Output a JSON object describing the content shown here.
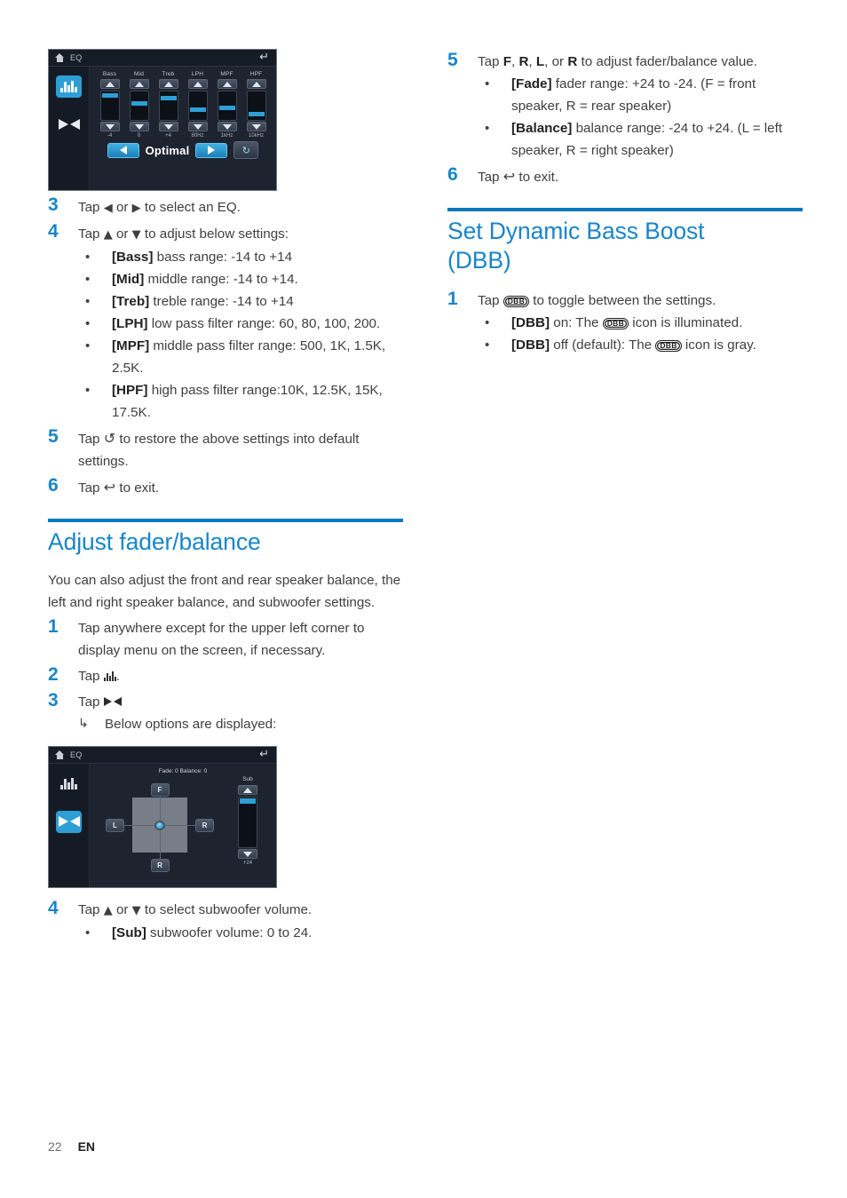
{
  "document": {
    "page_number": "22",
    "language_code": "EN"
  },
  "eq_screenshot": {
    "topbar": {
      "title": "EQ",
      "home_icon": "home-icon",
      "back_icon": "back-arrow-icon"
    },
    "rail": [
      {
        "icon": "equalizer-bars-icon",
        "active": true
      },
      {
        "icon": "fader-balance-bowtie-icon",
        "active": false
      }
    ],
    "channels": [
      {
        "label": "Bass",
        "value": "-4",
        "fill_top_pct": 8
      },
      {
        "label": "Mid",
        "value": "0",
        "fill_top_pct": 35
      },
      {
        "label": "Treb",
        "value": "+4",
        "fill_top_pct": 18
      },
      {
        "label": "LPH",
        "value": "80Hz",
        "fill_top_pct": 58
      },
      {
        "label": "MPF",
        "value": "1kHz",
        "fill_top_pct": 52
      },
      {
        "label": "HPF",
        "value": "10kHz",
        "fill_top_pct": 74
      }
    ],
    "preset": "Optimal",
    "prev_icon": "previous-preset-icon",
    "next_icon": "next-preset-icon",
    "reset_icon": "reset-icon"
  },
  "fader_screenshot": {
    "topbar": {
      "title": "EQ",
      "home_icon": "home-icon",
      "back_icon": "back-arrow-icon"
    },
    "rail": [
      {
        "icon": "equalizer-bars-icon",
        "active": false
      },
      {
        "icon": "fader-balance-bowtie-icon",
        "active": true
      }
    ],
    "readout": "Fade: 0 Balance: 0",
    "pad_buttons": {
      "front": "F",
      "rear": "R",
      "left": "L",
      "right": "R"
    },
    "sub": {
      "label": "Sub",
      "value": "+24"
    }
  },
  "left_column": {
    "step3": {
      "num": "3",
      "text_before": "Tap ",
      "glyph_left": "◀",
      "text_mid": " or ",
      "glyph_right": "▶",
      "text_after": " to select an EQ."
    },
    "step4": {
      "num": "4",
      "text_before": "Tap ",
      "glyph_up": "▲",
      "text_mid": " or ",
      "glyph_down": "▼",
      "text_after": " to adjust below settings:",
      "bullets": [
        {
          "term": "[Bass]",
          "text": " bass range: -14 to +14"
        },
        {
          "term": "[Mid]",
          "text": " middle range: -14 to +14."
        },
        {
          "term": "[Treb]",
          "text": " treble range: -14 to +14"
        },
        {
          "term": "[LPH]",
          "text": " low pass filter range: 60, 80, 100, 200."
        },
        {
          "term": "[MPF]",
          "text": " middle pass filter range: 500, 1K, 1.5K, 2.5K."
        },
        {
          "term": "[HPF]",
          "text": " high pass filter range:10K, 12.5K, 15K, 17.5K."
        }
      ]
    },
    "step5": {
      "num": "5",
      "text_before": "Tap ",
      "glyph": "↺",
      "text_after": " to restore the above settings into default settings."
    },
    "step6": {
      "num": "6",
      "text_before": "Tap ",
      "glyph": "↩",
      "text_after": " to exit."
    },
    "heading": "Adjust fader/balance",
    "intro": "You can also adjust the front and rear speaker balance, the left and right speaker balance, and subwoofer settings.",
    "fb_step1": {
      "num": "1",
      "text": "Tap anywhere except for the upper left corner to display menu on the screen, if necessary."
    },
    "fb_step2": {
      "num": "2",
      "text_before": "Tap ",
      "icon": "equalizer-bars-icon",
      "text_after": "."
    },
    "fb_step3": {
      "num": "3",
      "text_before": "Tap ",
      "icon": "fader-balance-bowtie-icon",
      "sub_arrow": "↳",
      "sub_text": "Below options are displayed:"
    },
    "fb_step4": {
      "num": "4",
      "text_before": "Tap ",
      "glyph_up": "▲",
      "text_mid": " or ",
      "glyph_down": "▼",
      "text_after": " to select subwoofer volume.",
      "bullets": [
        {
          "term": "[Sub]",
          "text": " subwoofer volume: 0 to 24."
        }
      ]
    }
  },
  "right_column": {
    "step5": {
      "num": "5",
      "text_before": "Tap ",
      "k1": "F",
      "sep1": ", ",
      "k2": "R",
      "sep2": ", ",
      "k3": "L",
      "sep3": ", or ",
      "k4": "R",
      "text_after": " to adjust fader/balance value.",
      "bullets": [
        {
          "term": "[Fade]",
          "text": " fader range: +24 to -24. (F = front speaker, R = rear speaker)"
        },
        {
          "term": "[Balance]",
          "text": " balance range: -24 to +24. (L = left speaker, R = right speaker)"
        }
      ]
    },
    "step6": {
      "num": "6",
      "text_before": "Tap ",
      "glyph": "↩",
      "text_after": " to exit."
    },
    "heading_line1": "Set Dynamic Bass Boost",
    "heading_line2": "(DBB)",
    "dbb_step1": {
      "num": "1",
      "text_before": "Tap ",
      "icon_label": "DBB",
      "text_after": " to toggle between the settings.",
      "bullets": [
        {
          "term": "[DBB]",
          "text_a": " on: The ",
          "icon_label": "DBB",
          "text_b": " icon is illuminated."
        },
        {
          "term": "[DBB]",
          "text_a": " off (default): The ",
          "icon_label": "DBB",
          "text_b": " icon is gray."
        }
      ]
    }
  },
  "colors": {
    "accent_blue": "#1985c8",
    "rule_blue": "#0079bf",
    "device_blue": "#2e9fd6",
    "body_text": "#3f3f3f"
  }
}
